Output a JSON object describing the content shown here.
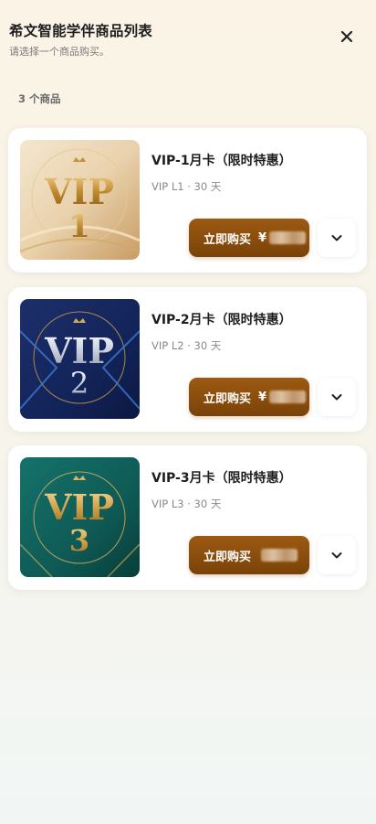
{
  "header": {
    "title": "希文智能学伴商品列表",
    "subtitle": "请选择一个商品购买。"
  },
  "product_count": "3 个商品",
  "products": [
    {
      "name": "VIP-1月卡（限时特惠）",
      "meta": "VIP L1 · 30 天",
      "buy_label": "立即购买",
      "currency": "¥",
      "thumb_text": "VIP",
      "thumb_number": "1",
      "thumb_theme": "gold"
    },
    {
      "name": "VIP-2月卡（限时特惠）",
      "meta": "VIP L2 · 30 天",
      "buy_label": "立即购买",
      "currency": "¥",
      "thumb_text": "VIP",
      "thumb_number": "2",
      "thumb_theme": "navy"
    },
    {
      "name": "VIP-3月卡（限时特惠）",
      "meta": "VIP L3 · 30 天",
      "buy_label": "立即购买",
      "currency": "",
      "thumb_text": "VIP",
      "thumb_number": "3",
      "thumb_theme": "teal"
    }
  ],
  "colors": {
    "button_top": "#9c5a12",
    "button_bottom": "#7a4208",
    "gold": "#d4a94f",
    "navy": "#14265a",
    "teal": "#0f5a55"
  }
}
